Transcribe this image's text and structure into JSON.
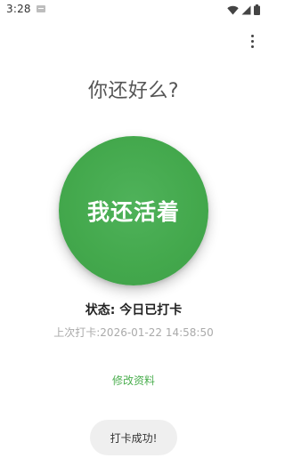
{
  "status_bar": {
    "time": "3:28",
    "icons": [
      "notification-icon",
      "wifi-icon",
      "signal-icon",
      "battery-icon"
    ]
  },
  "header": {
    "menu_icon": "overflow-menu-icon"
  },
  "main": {
    "greeting": "你还好么?",
    "alive_button_label": "我还活着",
    "status_text": "状态: 今日已打卡",
    "last_checkin_text": "上次打卡:2026-01-22 14:58:50",
    "edit_profile_label": "修改资料"
  },
  "toast": {
    "message": "打卡成功!"
  },
  "colors": {
    "accent": "#4caf50",
    "button_green": "#43a84c",
    "toast_bg": "#efefef"
  }
}
